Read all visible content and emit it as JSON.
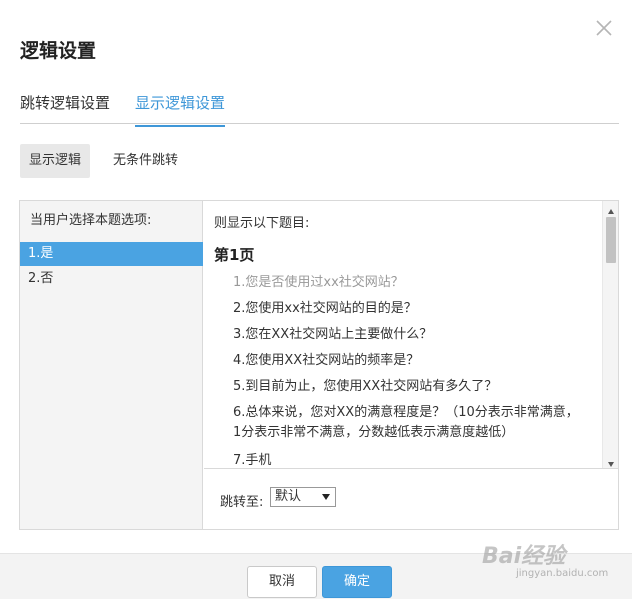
{
  "dialog": {
    "title": "逻辑设置",
    "close_icon": "close-icon"
  },
  "tabs": [
    {
      "label": "跳转逻辑设置",
      "active": false
    },
    {
      "label": "显示逻辑设置",
      "active": true
    }
  ],
  "subtabs": [
    {
      "label": "显示逻辑",
      "active": true
    },
    {
      "label": "无条件跳转",
      "active": false
    }
  ],
  "left_panel": {
    "header": "当用户选择本题选项:",
    "options": [
      {
        "label": "1.是",
        "selected": true
      },
      {
        "label": "2.否",
        "selected": false
      }
    ]
  },
  "right_panel": {
    "header": "则显示以下题目:",
    "page_label": "第1页",
    "questions": [
      {
        "text": "1.您是否使用过xx社交网站？",
        "disabled": true
      },
      {
        "text": "2.您使用xx社交网站的目的是？",
        "disabled": false
      },
      {
        "text": "3.您在XX社交网站上主要做什么？",
        "disabled": false
      },
      {
        "text": "4.您使用XX社交网站的频率是？",
        "disabled": false
      },
      {
        "text": "5.到目前为止，您使用XX社交网站有多久了？",
        "disabled": false
      },
      {
        "text": "6.总体来说，您对XX的满意程度是？（10分表示非常满意，1分表示非常不满意，分数越低表示满意度越低）",
        "disabled": false
      },
      {
        "text": "7.手机",
        "disabled": false
      }
    ]
  },
  "jump": {
    "label": "跳转至:",
    "value": "默认"
  },
  "footer": {
    "cancel_label": "取消",
    "confirm_label": "确定"
  },
  "watermark": {
    "text": "Bai经验",
    "sub": "jingyan.baidu.com"
  },
  "colors": {
    "accent": "#3e97d8",
    "selected_bg": "#4aa3e2",
    "panel_bg": "#f4f4f4"
  }
}
